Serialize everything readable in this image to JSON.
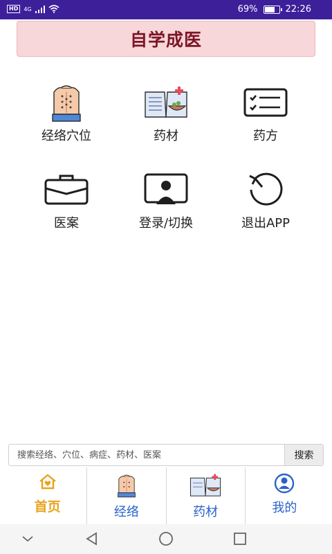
{
  "status_bar": {
    "hd": "HD",
    "network": "4G",
    "battery_percent": "69%",
    "battery_level": 0.69,
    "time": "22:26"
  },
  "header": {
    "title": "自学成医"
  },
  "tiles": [
    {
      "label": "经络穴位",
      "icon": "back-acupoints-icon"
    },
    {
      "label": "药材",
      "icon": "herb-book-icon"
    },
    {
      "label": "药方",
      "icon": "checklist-icon"
    },
    {
      "label": "医案",
      "icon": "briefcase-icon"
    },
    {
      "label": "登录/切换",
      "icon": "user-monitor-icon"
    },
    {
      "label": "退出APP",
      "icon": "rotate-back-icon"
    }
  ],
  "search": {
    "placeholder": "搜索经络、穴位、病症、药材、医案",
    "button": "搜索"
  },
  "tabbar": [
    {
      "label": "首页",
      "icon": "home-heart-icon",
      "active": true
    },
    {
      "label": "经络",
      "icon": "back-acupoints-icon",
      "active": false
    },
    {
      "label": "药材",
      "icon": "herb-book-icon",
      "active": false
    },
    {
      "label": "我的",
      "icon": "user-circle-icon",
      "active": false
    }
  ],
  "colors": {
    "status_bar": "#3d1f9a",
    "header_bg": "#f8d7da",
    "header_text": "#7b1626",
    "tab_active": "#e8a31a",
    "tab_inactive": "#2a62c9"
  }
}
